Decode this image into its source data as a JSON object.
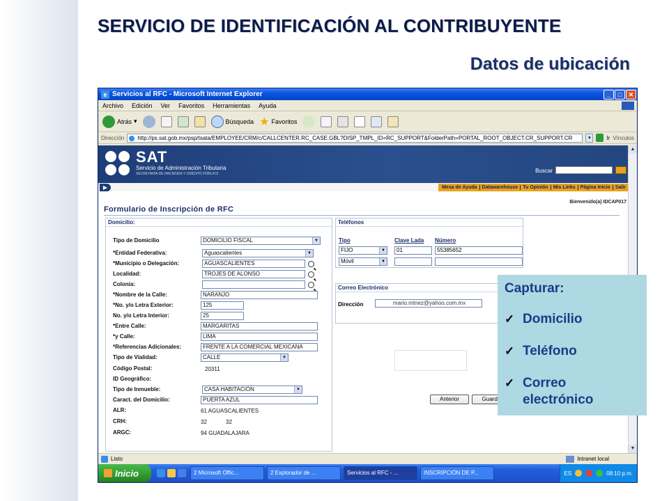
{
  "slide": {
    "title": "SERVICIO DE IDENTIFICACIÓN AL CONTRIBUYENTE",
    "subtitle": "Datos de ubicación"
  },
  "browser": {
    "title": "Servicios al RFC - Microsoft Internet Explorer",
    "menu": [
      "Archivo",
      "Edición",
      "Ver",
      "Favoritos",
      "Herramientas",
      "Ayuda"
    ],
    "toolbar": {
      "back": "Atrás",
      "search": "Búsqueda",
      "favorites": "Favoritos"
    },
    "address_label": "Dirección",
    "url": "http://ps.sat.gob.mx/psp/tsata/EMPLOYEE/CRM/c/CALLCENTER.RC_CASE.GBL?DISP_TMPL_ID=RC_SUPPORT&FolderPath=PORTAL_ROOT_OBJECT.CR_SUPPORT.CR",
    "go_label": "Ir",
    "links_label": "Vínculos",
    "status": "Listo",
    "zone": "Intranet local"
  },
  "sat": {
    "name": "SAT",
    "full_name": "Servicio de Administración Tributaria",
    "ministry": "SECRETARÍA DE HACIENDA Y CRÉDITO PÚBLICO",
    "search_label": "Buscar",
    "nav": [
      "Mesa de Ayuda",
      "Datawarehouse",
      "Tu Opinión",
      "Mis Links",
      "Página Inicio",
      "Salir"
    ],
    "welcome": "Bienvenido(a) IDCAP017"
  },
  "form": {
    "title": "Formulario de Inscripción de RFC",
    "domicilio_header": "Domicilio:",
    "telefonos_header": "Teléfonos",
    "correo_header": "Correo Electrónico",
    "fields": {
      "tipo_domicilio": {
        "label": "Tipo de Domicilio",
        "value": "DOMICILIO FISCAL"
      },
      "entidad": {
        "label": "*Entidad Federativa:",
        "value": "Aguascalientes"
      },
      "municipio": {
        "label": "*Municipio o Delegación:",
        "value": "AGUASCALIENTES"
      },
      "localidad": {
        "label": "Localidad:",
        "value": "TROJES DE ALONSO"
      },
      "colonia": {
        "label": "Colonia:",
        "value": ""
      },
      "calle": {
        "label": "*Nombre de la Calle:",
        "value": "NARANJO"
      },
      "no_exterior": {
        "label": "*No. y/o Letra Exterior:",
        "value": "125"
      },
      "no_interior": {
        "label": "No. y/o Letra Interior:",
        "value": "25"
      },
      "entre_calle": {
        "label": "*Entre Calle:",
        "value": "MARGARITAS"
      },
      "y_calle": {
        "label": "*y Calle:",
        "value": "LIMA"
      },
      "referencias": {
        "label": "*Referencias Adicionales:",
        "value": "FRENTE A LA COMERCIAL MEXICANA"
      },
      "tipo_vialidad": {
        "label": "Tipo de Vialidad:",
        "value": "CALLE"
      },
      "codigo_postal": {
        "label": "Código Postal:",
        "value": "20311"
      },
      "id_geografico": {
        "label": "ID Geográfico:",
        "value": ""
      },
      "tipo_inmueble": {
        "label": "Tipo de Inmueble:",
        "value": "CASA HABITACIÓN"
      },
      "caract_domicilio": {
        "label": "Caract. del Domicilio:",
        "value": "PUERTA AZUL"
      },
      "alr": {
        "label": "ALR:",
        "value": "61 AGUASCALIENTES"
      },
      "crh": {
        "label": "CRH:",
        "value1": "32",
        "value2": "32"
      },
      "argc": {
        "label": "ARGC:",
        "value": "94 GUADALAJARA"
      }
    },
    "telefonos": {
      "headers": [
        "Tipo",
        "Clave Lada",
        "Número"
      ],
      "rows": [
        {
          "tipo": "FIJO",
          "lada": "01",
          "numero": "55385652"
        },
        {
          "tipo": "Móvil",
          "lada": "",
          "numero": ""
        }
      ]
    },
    "correo": {
      "label": "Dirección",
      "value": "mario.mtnez@yahoo.com.mx"
    },
    "buttons": {
      "anterior": "Anterior",
      "guardar": "Guarda"
    }
  },
  "taskbar": {
    "start": "Inicio",
    "tasks": [
      "2 Microsoft Offic...",
      "2 Explorador de ...",
      "Servicios al RFC - ...",
      "INSCRIPCIÓN DE P..."
    ],
    "lang": "ES",
    "clock": "08:10 p.m."
  },
  "callout": {
    "title": "Capturar:",
    "items": [
      "Domicilio",
      "Teléfono",
      "Correo electrónico"
    ]
  }
}
